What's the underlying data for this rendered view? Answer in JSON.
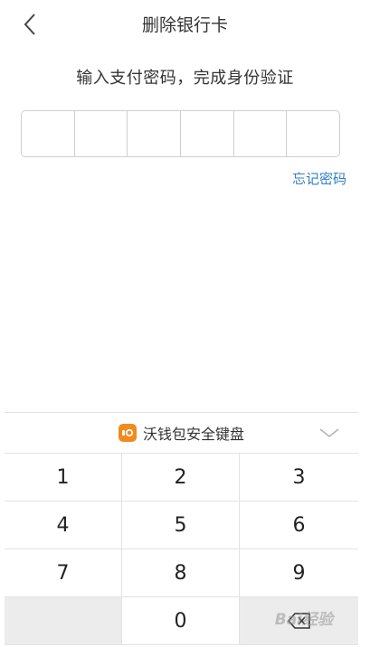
{
  "nav": {
    "title": "删除银行卡",
    "back_icon": "chevron-left-icon"
  },
  "prompt": "输入支付密码，完成身份验证",
  "pin": {
    "length": 6,
    "entered": 0
  },
  "forgot_password": "忘记密码",
  "keyboard": {
    "title": "沃钱包安全键盘",
    "logo_icon": "wo-wallet-logo-icon",
    "collapse_icon": "chevron-down-icon",
    "keys": [
      "1",
      "2",
      "3",
      "4",
      "5",
      "6",
      "7",
      "8",
      "9",
      "",
      "0",
      "⌫"
    ],
    "delete_icon": "backspace-icon"
  },
  "colors": {
    "link": "#2f80c5",
    "logo": "#f28a1d",
    "key_gray": "#ececec",
    "border": "#e2e2e2"
  },
  "watermark": "Bai经验"
}
